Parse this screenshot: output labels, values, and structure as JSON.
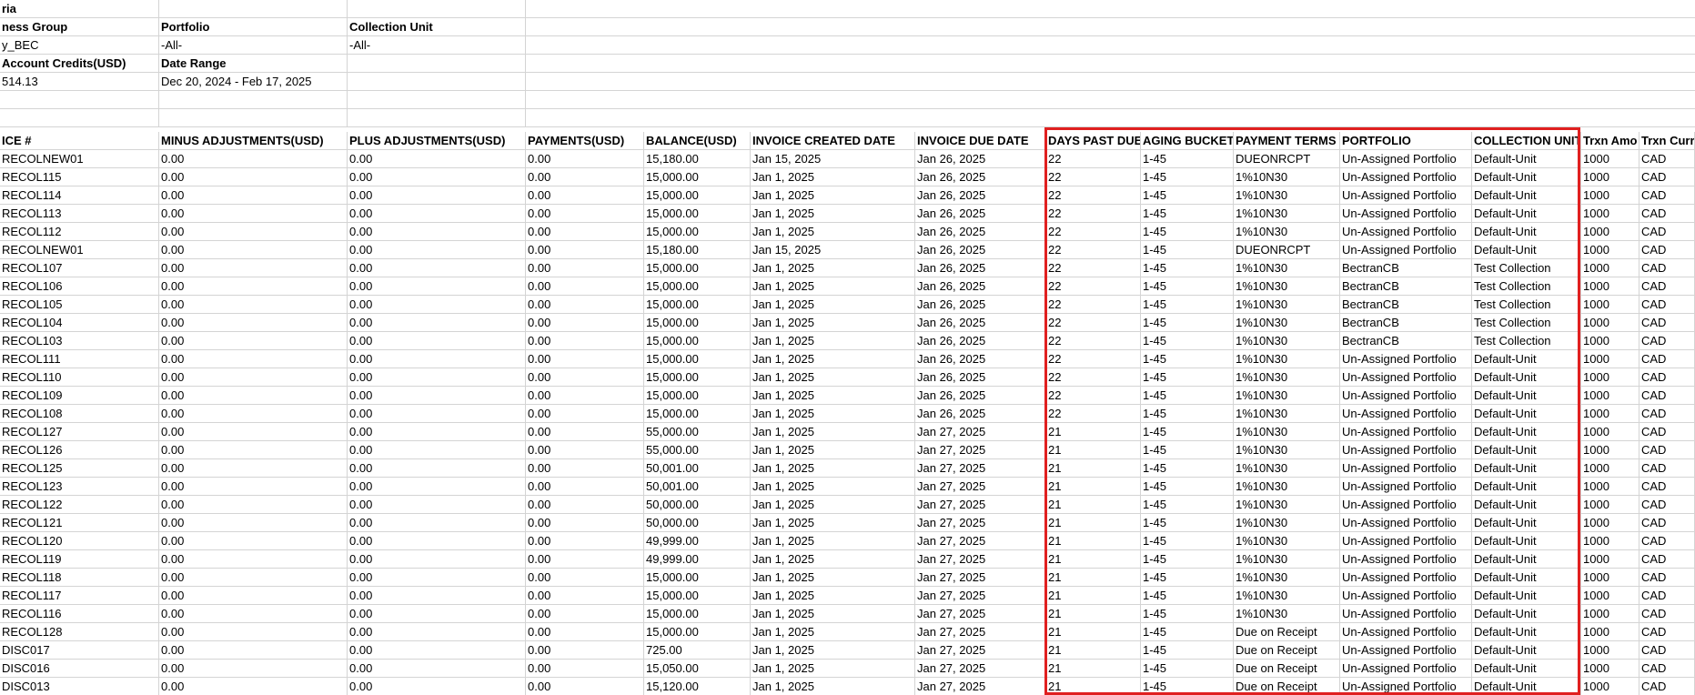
{
  "filters": {
    "criteria_label": "ria",
    "labels": [
      "ness Group",
      "Portfolio",
      "Collection Unit"
    ],
    "values": [
      "y_BEC",
      "-All-",
      "-All-"
    ],
    "labels2": [
      " Account Credits(USD)",
      "Date Range"
    ],
    "values2": [
      "514.13",
      "Dec 20, 2024 - Feb 17, 2025"
    ]
  },
  "table": {
    "headers": [
      "ICE #",
      "MINUS ADJUSTMENTS(USD)",
      "PLUS ADJUSTMENTS(USD)",
      "PAYMENTS(USD)",
      "BALANCE(USD)",
      "INVOICE CREATED DATE",
      "INVOICE DUE DATE",
      "DAYS PAST DUE",
      "AGING BUCKET",
      "PAYMENT TERMS",
      "PORTFOLIO",
      "COLLECTION UNIT",
      "Trxn Amo",
      "Trxn Curre"
    ],
    "rows": [
      [
        "RECOLNEW01",
        "0.00",
        "0.00",
        "0.00",
        "15,180.00",
        "Jan 15, 2025",
        "Jan 26, 2025",
        "22",
        "1-45",
        "DUEONRCPT",
        "Un-Assigned Portfolio",
        "Default-Unit",
        "1000",
        "CAD"
      ],
      [
        "RECOL115",
        "0.00",
        "0.00",
        "0.00",
        "15,000.00",
        "Jan 1, 2025",
        "Jan 26, 2025",
        "22",
        "1-45",
        "1%10N30",
        "Un-Assigned Portfolio",
        "Default-Unit",
        "1000",
        "CAD"
      ],
      [
        "RECOL114",
        "0.00",
        "0.00",
        "0.00",
        "15,000.00",
        "Jan 1, 2025",
        "Jan 26, 2025",
        "22",
        "1-45",
        "1%10N30",
        "Un-Assigned Portfolio",
        "Default-Unit",
        "1000",
        "CAD"
      ],
      [
        "RECOL113",
        "0.00",
        "0.00",
        "0.00",
        "15,000.00",
        "Jan 1, 2025",
        "Jan 26, 2025",
        "22",
        "1-45",
        "1%10N30",
        "Un-Assigned Portfolio",
        "Default-Unit",
        "1000",
        "CAD"
      ],
      [
        "RECOL112",
        "0.00",
        "0.00",
        "0.00",
        "15,000.00",
        "Jan 1, 2025",
        "Jan 26, 2025",
        "22",
        "1-45",
        "1%10N30",
        "Un-Assigned Portfolio",
        "Default-Unit",
        "1000",
        "CAD"
      ],
      [
        "RECOLNEW01",
        "0.00",
        "0.00",
        "0.00",
        "15,180.00",
        "Jan 15, 2025",
        "Jan 26, 2025",
        "22",
        "1-45",
        "DUEONRCPT",
        "Un-Assigned Portfolio",
        "Default-Unit",
        "1000",
        "CAD"
      ],
      [
        "RECOL107",
        "0.00",
        "0.00",
        "0.00",
        "15,000.00",
        "Jan 1, 2025",
        "Jan 26, 2025",
        "22",
        "1-45",
        "1%10N30",
        "BectranCB",
        "Test Collection",
        "1000",
        "CAD"
      ],
      [
        "RECOL106",
        "0.00",
        "0.00",
        "0.00",
        "15,000.00",
        "Jan 1, 2025",
        "Jan 26, 2025",
        "22",
        "1-45",
        "1%10N30",
        "BectranCB",
        "Test Collection",
        "1000",
        "CAD"
      ],
      [
        "RECOL105",
        "0.00",
        "0.00",
        "0.00",
        "15,000.00",
        "Jan 1, 2025",
        "Jan 26, 2025",
        "22",
        "1-45",
        "1%10N30",
        "BectranCB",
        "Test Collection",
        "1000",
        "CAD"
      ],
      [
        "RECOL104",
        "0.00",
        "0.00",
        "0.00",
        "15,000.00",
        "Jan 1, 2025",
        "Jan 26, 2025",
        "22",
        "1-45",
        "1%10N30",
        "BectranCB",
        "Test Collection",
        "1000",
        "CAD"
      ],
      [
        "RECOL103",
        "0.00",
        "0.00",
        "0.00",
        "15,000.00",
        "Jan 1, 2025",
        "Jan 26, 2025",
        "22",
        "1-45",
        "1%10N30",
        "BectranCB",
        "Test Collection",
        "1000",
        "CAD"
      ],
      [
        "RECOL111",
        "0.00",
        "0.00",
        "0.00",
        "15,000.00",
        "Jan 1, 2025",
        "Jan 26, 2025",
        "22",
        "1-45",
        "1%10N30",
        "Un-Assigned Portfolio",
        "Default-Unit",
        "1000",
        "CAD"
      ],
      [
        "RECOL110",
        "0.00",
        "0.00",
        "0.00",
        "15,000.00",
        "Jan 1, 2025",
        "Jan 26, 2025",
        "22",
        "1-45",
        "1%10N30",
        "Un-Assigned Portfolio",
        "Default-Unit",
        "1000",
        "CAD"
      ],
      [
        "RECOL109",
        "0.00",
        "0.00",
        "0.00",
        "15,000.00",
        "Jan 1, 2025",
        "Jan 26, 2025",
        "22",
        "1-45",
        "1%10N30",
        "Un-Assigned Portfolio",
        "Default-Unit",
        "1000",
        "CAD"
      ],
      [
        "RECOL108",
        "0.00",
        "0.00",
        "0.00",
        "15,000.00",
        "Jan 1, 2025",
        "Jan 26, 2025",
        "22",
        "1-45",
        "1%10N30",
        "Un-Assigned Portfolio",
        "Default-Unit",
        "1000",
        "CAD"
      ],
      [
        "RECOL127",
        "0.00",
        "0.00",
        "0.00",
        "55,000.00",
        "Jan 1, 2025",
        "Jan 27, 2025",
        "21",
        "1-45",
        "1%10N30",
        "Un-Assigned Portfolio",
        "Default-Unit",
        "1000",
        "CAD"
      ],
      [
        "RECOL126",
        "0.00",
        "0.00",
        "0.00",
        "55,000.00",
        "Jan 1, 2025",
        "Jan 27, 2025",
        "21",
        "1-45",
        "1%10N30",
        "Un-Assigned Portfolio",
        "Default-Unit",
        "1000",
        "CAD"
      ],
      [
        "RECOL125",
        "0.00",
        "0.00",
        "0.00",
        "50,001.00",
        "Jan 1, 2025",
        "Jan 27, 2025",
        "21",
        "1-45",
        "1%10N30",
        "Un-Assigned Portfolio",
        "Default-Unit",
        "1000",
        "CAD"
      ],
      [
        "RECOL123",
        "0.00",
        "0.00",
        "0.00",
        "50,001.00",
        "Jan 1, 2025",
        "Jan 27, 2025",
        "21",
        "1-45",
        "1%10N30",
        "Un-Assigned Portfolio",
        "Default-Unit",
        "1000",
        "CAD"
      ],
      [
        "RECOL122",
        "0.00",
        "0.00",
        "0.00",
        "50,000.00",
        "Jan 1, 2025",
        "Jan 27, 2025",
        "21",
        "1-45",
        "1%10N30",
        "Un-Assigned Portfolio",
        "Default-Unit",
        "1000",
        "CAD"
      ],
      [
        "RECOL121",
        "0.00",
        "0.00",
        "0.00",
        "50,000.00",
        "Jan 1, 2025",
        "Jan 27, 2025",
        "21",
        "1-45",
        "1%10N30",
        "Un-Assigned Portfolio",
        "Default-Unit",
        "1000",
        "CAD"
      ],
      [
        "RECOL120",
        "0.00",
        "0.00",
        "0.00",
        "49,999.00",
        "Jan 1, 2025",
        "Jan 27, 2025",
        "21",
        "1-45",
        "1%10N30",
        "Un-Assigned Portfolio",
        "Default-Unit",
        "1000",
        "CAD"
      ],
      [
        "RECOL119",
        "0.00",
        "0.00",
        "0.00",
        "49,999.00",
        "Jan 1, 2025",
        "Jan 27, 2025",
        "21",
        "1-45",
        "1%10N30",
        "Un-Assigned Portfolio",
        "Default-Unit",
        "1000",
        "CAD"
      ],
      [
        "RECOL118",
        "0.00",
        "0.00",
        "0.00",
        "15,000.00",
        "Jan 1, 2025",
        "Jan 27, 2025",
        "21",
        "1-45",
        "1%10N30",
        "Un-Assigned Portfolio",
        "Default-Unit",
        "1000",
        "CAD"
      ],
      [
        "RECOL117",
        "0.00",
        "0.00",
        "0.00",
        "15,000.00",
        "Jan 1, 2025",
        "Jan 27, 2025",
        "21",
        "1-45",
        "1%10N30",
        "Un-Assigned Portfolio",
        "Default-Unit",
        "1000",
        "CAD"
      ],
      [
        "RECOL116",
        "0.00",
        "0.00",
        "0.00",
        "15,000.00",
        "Jan 1, 2025",
        "Jan 27, 2025",
        "21",
        "1-45",
        "1%10N30",
        "Un-Assigned Portfolio",
        "Default-Unit",
        "1000",
        "CAD"
      ],
      [
        "RECOL128",
        "0.00",
        "0.00",
        "0.00",
        "15,000.00",
        "Jan 1, 2025",
        "Jan 27, 2025",
        "21",
        "1-45",
        "Due on Receipt",
        "Un-Assigned Portfolio",
        "Default-Unit",
        "1000",
        "CAD"
      ],
      [
        "DISC017",
        "0.00",
        "0.00",
        "0.00",
        "725.00",
        "Jan 1, 2025",
        "Jan 27, 2025",
        "21",
        "1-45",
        "Due on Receipt",
        "Un-Assigned Portfolio",
        "Default-Unit",
        "1000",
        "CAD"
      ],
      [
        "DISC016",
        "0.00",
        "0.00",
        "0.00",
        "15,050.00",
        "Jan 1, 2025",
        "Jan 27, 2025",
        "21",
        "1-45",
        "Due on Receipt",
        "Un-Assigned Portfolio",
        "Default-Unit",
        "1000",
        "CAD"
      ],
      [
        "DISC013",
        "0.00",
        "0.00",
        "0.00",
        "15,120.00",
        "Jan 1, 2025",
        "Jan 27, 2025",
        "21",
        "1-45",
        "Due on Receipt",
        "Un-Assigned Portfolio",
        "Default-Unit",
        "1000",
        "CAD"
      ]
    ]
  },
  "highlight": {
    "color": "#e02020",
    "columns": [
      "DAYS PAST DUE",
      "AGING BUCKET",
      "PAYMENT TERMS",
      "PORTFOLIO",
      "COLLECTION UNIT"
    ]
  }
}
